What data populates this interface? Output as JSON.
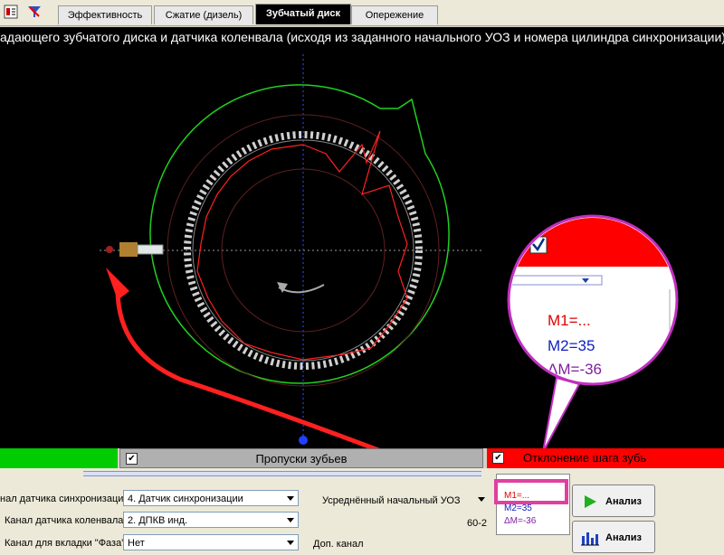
{
  "toolbar": {
    "tabs": [
      "Эффективность",
      "Сжатие (дизель)",
      "Зубчатый диск",
      "Опережение"
    ],
    "active_tab": "Зубчатый диск"
  },
  "header": {
    "title": "адающего зубчатого диска и датчика коленвала (исходя из заданного начального УОЗ и номера цилиндра синхронизации)"
  },
  "strips": {
    "left": "",
    "middle": "Пропуски зубьев",
    "right": "Отклонение шага зубь"
  },
  "zoom": {
    "m1": "M1=...",
    "m2": "M2=35",
    "dm": "ΔM=-36"
  },
  "form": {
    "sync_channel_label": "нал датчика синхронизации",
    "sync_channel_value": "4.  Датчик синхронизации",
    "crank_channel_label": "Канал датчика коленвала",
    "crank_channel_value": "2.  ДПКВ инд.",
    "phase_channel_label": "Канал для вкладки \"Фаза\"",
    "phase_channel_value": "Нет",
    "avg_uoz_label": "Усреднённый начальный УОЗ",
    "disk_type": "60-2",
    "extra_channel_label": "Доп. канал"
  },
  "measure": {
    "m1": "M1=...",
    "m2": "M2=35",
    "dm": "ΔM=-36"
  },
  "buttons": {
    "analyze1": "Анализ",
    "analyze2": "Анализ"
  },
  "colors": {
    "strip_left": "#00cc00",
    "strip_middle": "#b0b0b0",
    "strip_right": "#ff0000",
    "highlight": "#e040a0",
    "arrow": "#ff2020"
  }
}
